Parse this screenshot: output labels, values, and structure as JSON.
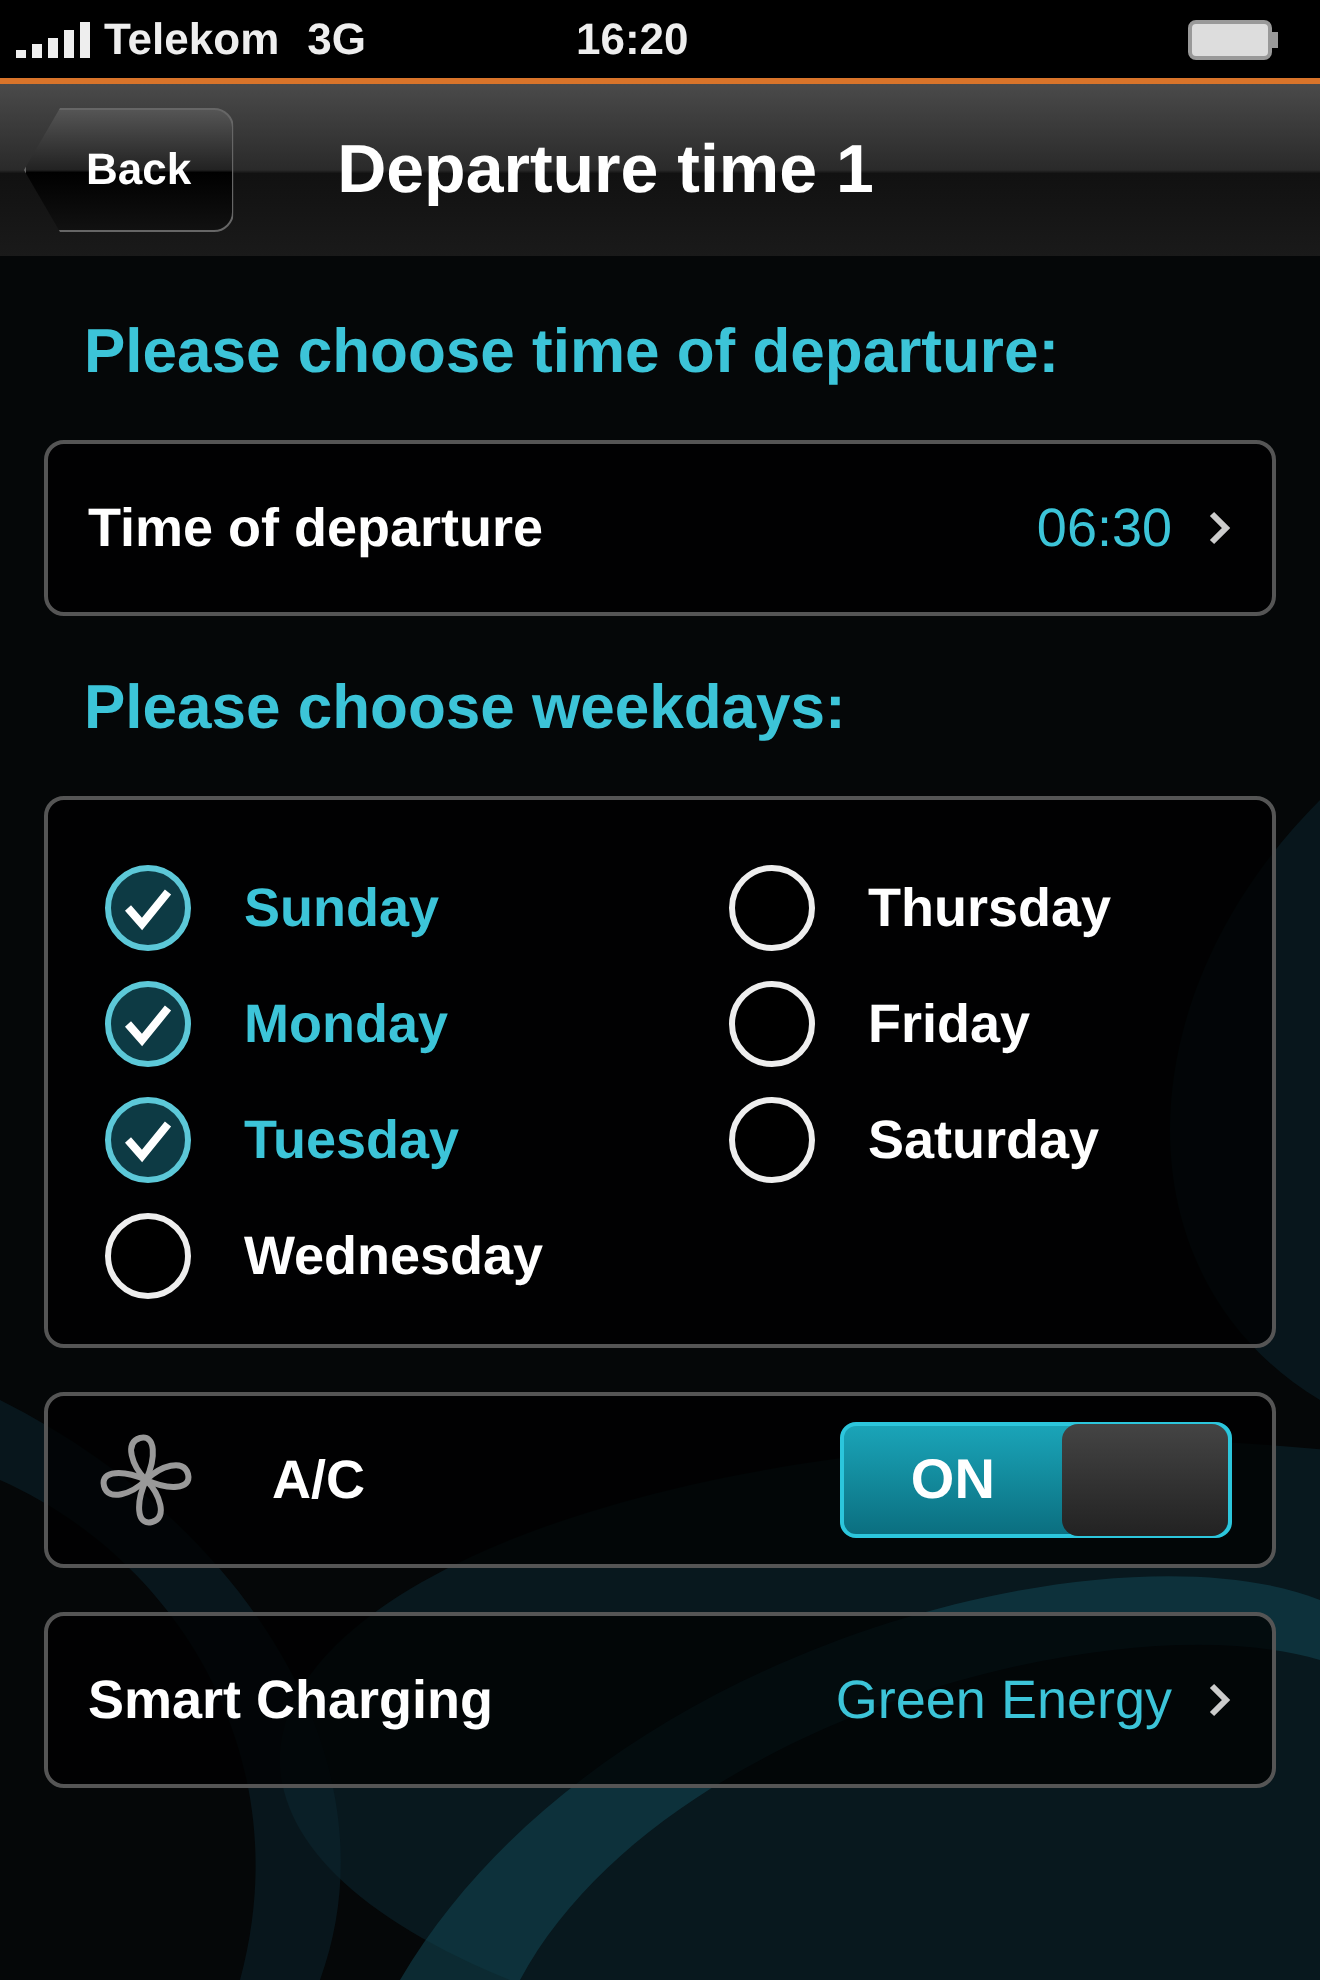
{
  "status_bar": {
    "carrier": "Telekom",
    "network": "3G",
    "time": "16:20"
  },
  "nav_bar": {
    "back": "Back",
    "title": "Departure time 1"
  },
  "time_section": {
    "heading": "Please choose time of departure:",
    "row": {
      "label": "Time of departure",
      "value": "06:30"
    }
  },
  "weekdays_section": {
    "heading": "Please choose weekdays:",
    "days": [
      {
        "label": "Sunday",
        "checked": true
      },
      {
        "label": "Monday",
        "checked": true
      },
      {
        "label": "Tuesday",
        "checked": true
      },
      {
        "label": "Wednesday",
        "checked": false
      },
      {
        "label": "Thursday",
        "checked": false
      },
      {
        "label": "Friday",
        "checked": false
      },
      {
        "label": "Saturday",
        "checked": false
      }
    ]
  },
  "ac": {
    "label": "A/C",
    "on": true,
    "switch_text": "ON"
  },
  "smart_charging": {
    "label": "Smart Charging",
    "value": "Green Energy"
  }
}
